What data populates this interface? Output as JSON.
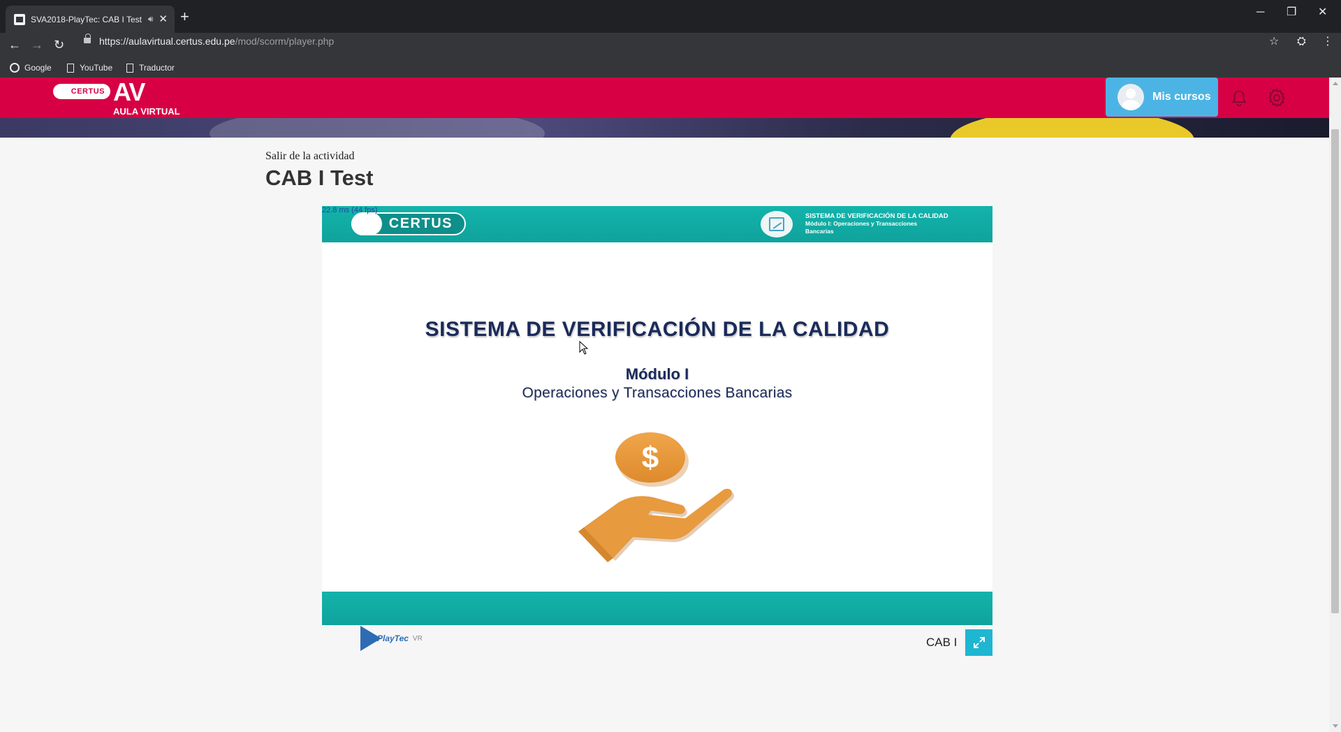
{
  "browser": {
    "tab_title": "SVA2018-PlayTec: CAB I Test",
    "url_host": "https://aulavirtual.certus.edu.pe",
    "url_path": "/mod/scorm/player.php",
    "bookmarks": [
      "Google",
      "YouTube",
      "Traductor"
    ]
  },
  "site": {
    "logo_badge": "CERTUS",
    "logo_av": "AV",
    "logo_subtitle": "AULA VIRTUAL",
    "mis_cursos": "Mis cursos",
    "colors": {
      "brand_red": "#d70045",
      "accent_blue": "#4cb4e4",
      "teal": "#13b3ab"
    }
  },
  "page": {
    "exit_link": "Salir de la actividad",
    "title": "CAB I Test"
  },
  "player": {
    "fps_readout": "22.8 ms (44 fps)",
    "header_logo": "CERTUS",
    "header_line1": "SISTEMA DE VERIFICACIÓN DE LA CALIDAD",
    "header_line2": "Módulo I: Operaciones y Transacciones",
    "header_line3": "Bancarias",
    "slide_title": "SISTEMA DE VERIFICACIÓN DE LA CALIDAD",
    "slide_module": "Módulo I",
    "slide_subtitle": "Operaciones y Transacciones Bancarias",
    "coin_symbol": "$",
    "brand_name": "PlayTec",
    "brand_suffix": "VR",
    "activity_label": "CAB I"
  }
}
